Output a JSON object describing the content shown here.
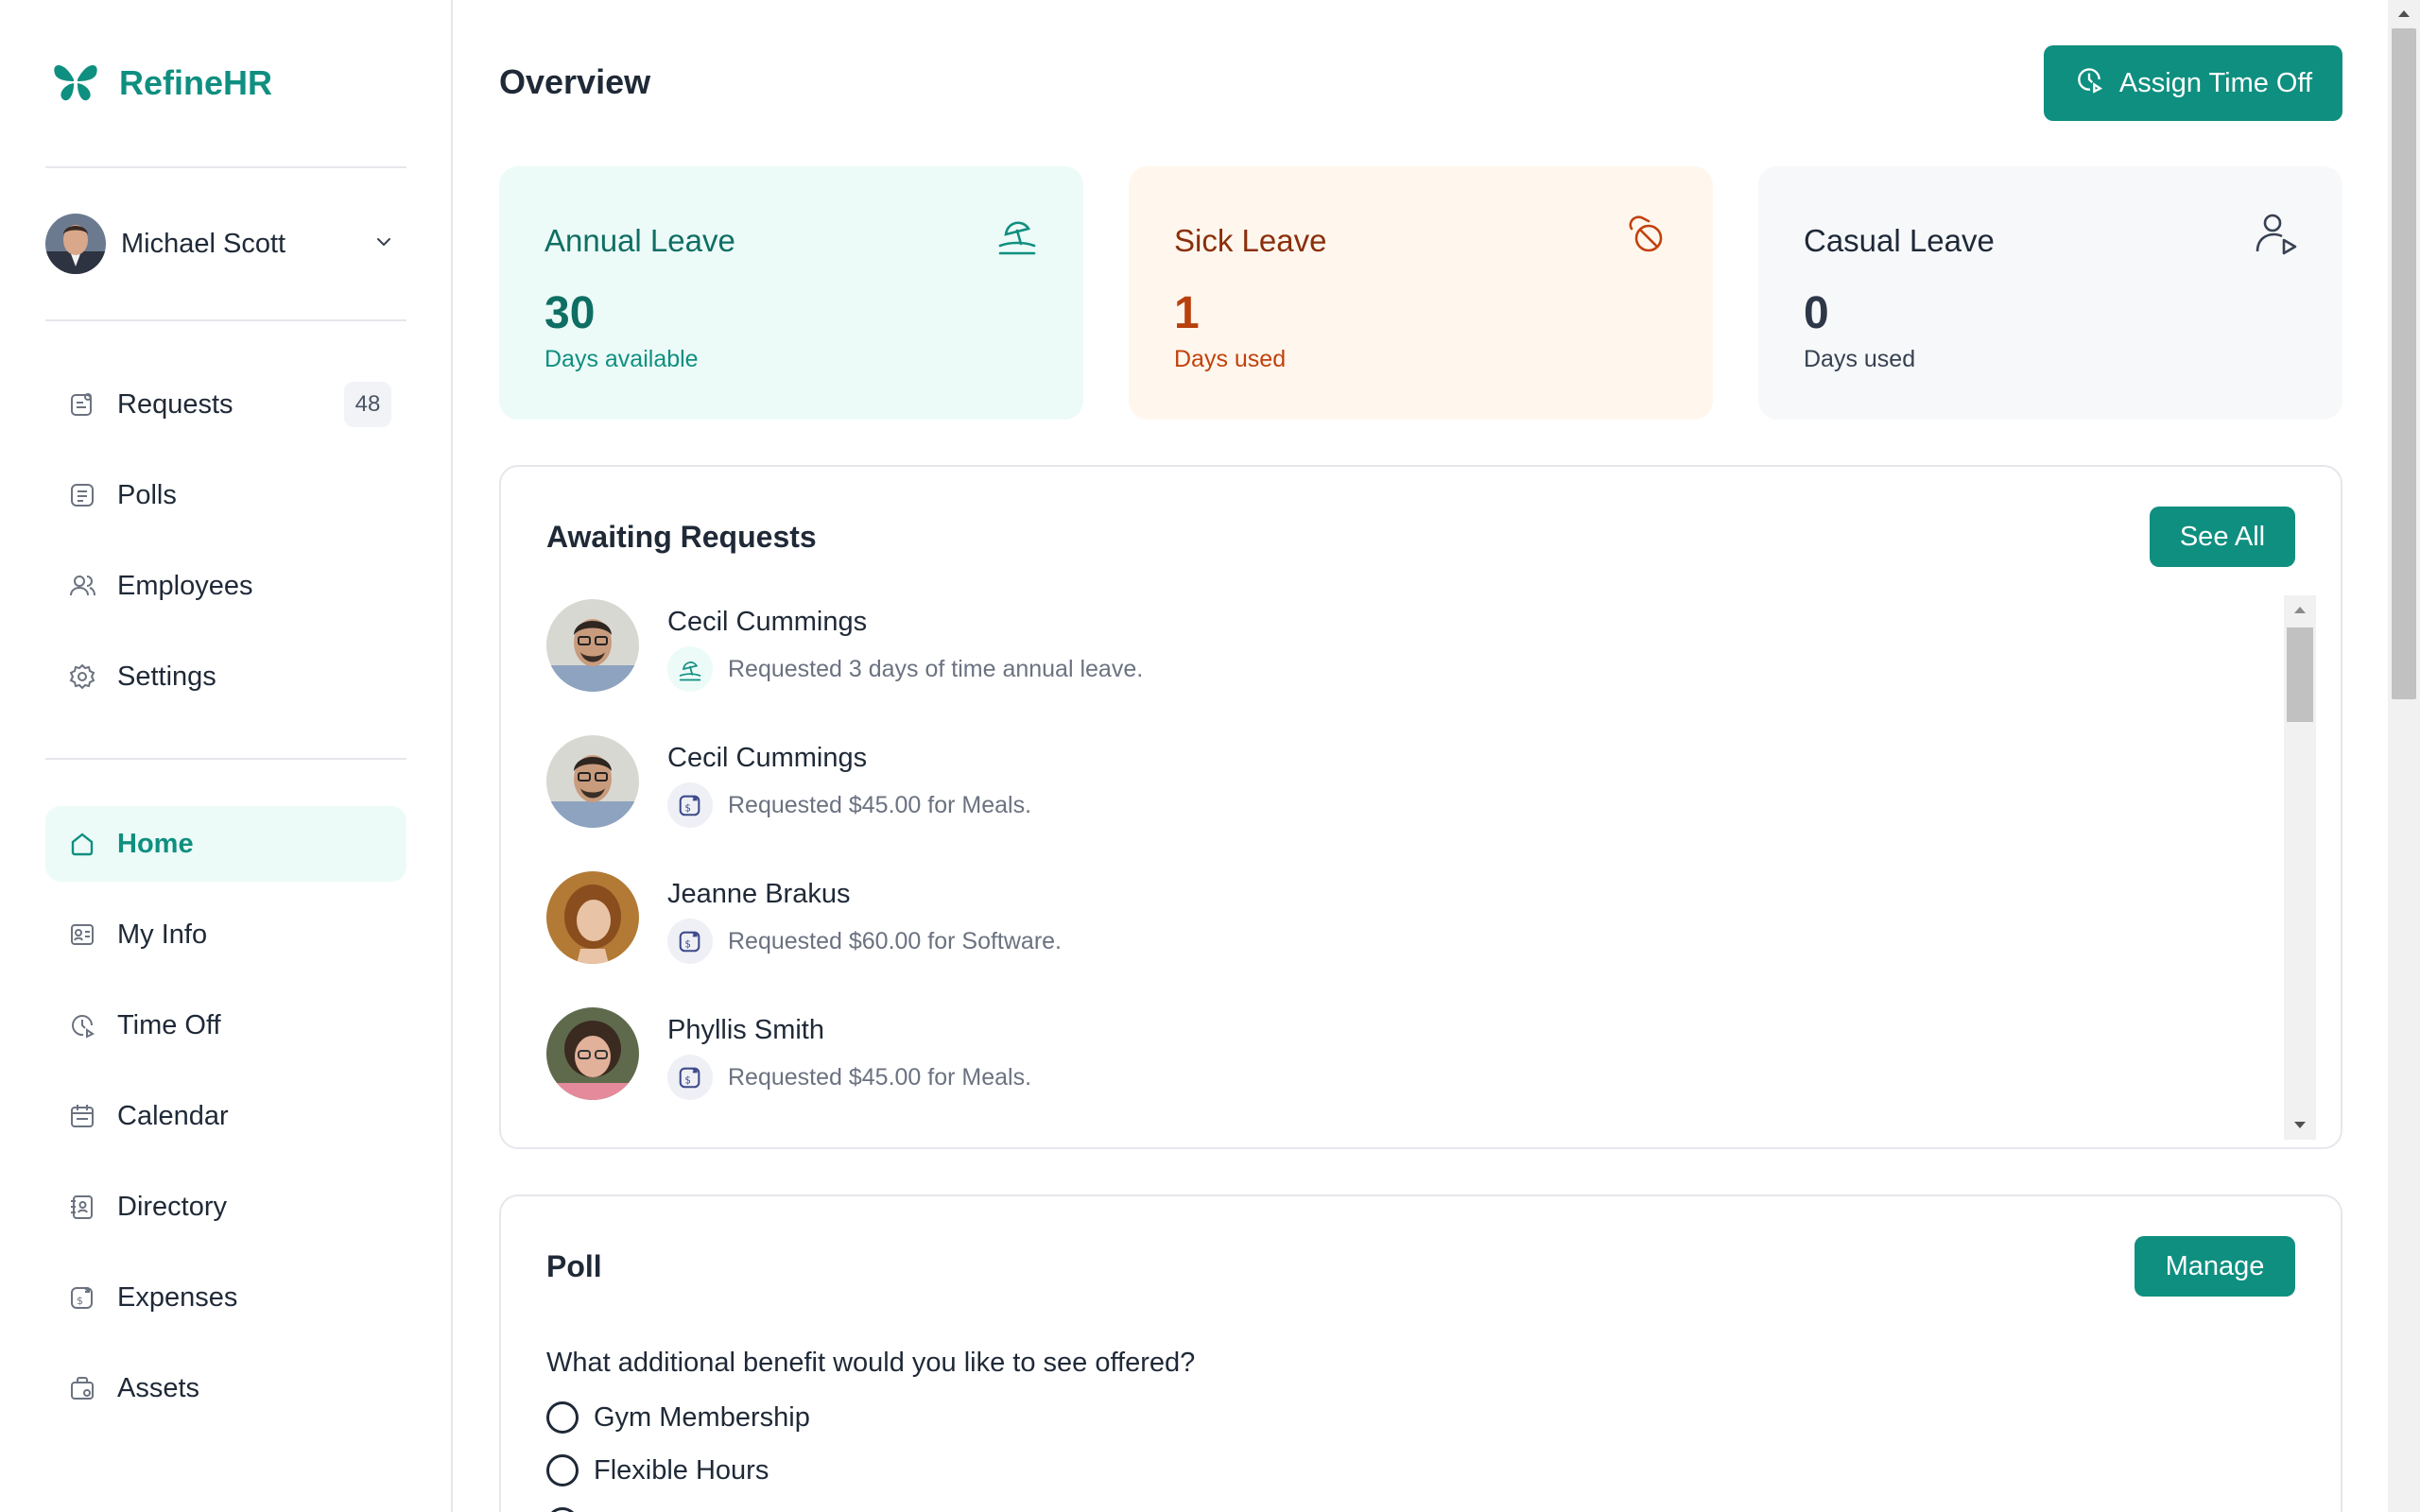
{
  "app": {
    "name": "RefineHR"
  },
  "user": {
    "name": "Michael Scott"
  },
  "nav_top": [
    {
      "label": "Requests",
      "badge": "48",
      "icon": "requests-icon"
    },
    {
      "label": "Polls",
      "icon": "polls-icon"
    },
    {
      "label": "Employees",
      "icon": "employees-icon"
    },
    {
      "label": "Settings",
      "icon": "settings-icon"
    }
  ],
  "nav_main": [
    {
      "label": "Home",
      "icon": "home-icon",
      "active": true
    },
    {
      "label": "My Info",
      "icon": "id-card-icon"
    },
    {
      "label": "Time Off",
      "icon": "time-off-icon"
    },
    {
      "label": "Calendar",
      "icon": "calendar-icon"
    },
    {
      "label": "Directory",
      "icon": "directory-icon"
    },
    {
      "label": "Expenses",
      "icon": "expenses-icon"
    },
    {
      "label": "Assets",
      "icon": "assets-icon"
    }
  ],
  "header": {
    "title": "Overview",
    "assign_button": "Assign Time Off"
  },
  "cards": [
    {
      "title": "Annual Leave",
      "value": "30",
      "sub": "Days available",
      "icon": "beach-icon",
      "bg": "#ecfbf8",
      "color": "#0f6e63"
    },
    {
      "title": "Sick Leave",
      "value": "1",
      "sub": "Days used",
      "icon": "pill-icon",
      "bg": "#fff6ed",
      "color": "#b8410e"
    },
    {
      "title": "Casual Leave",
      "value": "0",
      "sub": "Days used",
      "icon": "user-play-icon",
      "bg": "#f6f8fa",
      "color": "#2d3748"
    }
  ],
  "requests": {
    "title": "Awaiting Requests",
    "see_all": "See All",
    "items": [
      {
        "name": "Cecil Cummings",
        "text": "Requested 3 days of time annual leave.",
        "type": "time-off"
      },
      {
        "name": "Cecil Cummings",
        "text": "Requested $45.00 for Meals.",
        "type": "expense"
      },
      {
        "name": "Jeanne Brakus",
        "text": "Requested $60.00 for Software.",
        "type": "expense"
      },
      {
        "name": "Phyllis Smith",
        "text": "Requested $45.00 for Meals.",
        "type": "expense"
      }
    ]
  },
  "poll": {
    "title": "Poll",
    "manage": "Manage",
    "question": "What additional benefit would you like to see offered?",
    "options": [
      "Gym Membership",
      "Flexible Hours"
    ]
  },
  "colors": {
    "accent": "#0f8f80",
    "accent_light": "#ecfbf8"
  }
}
